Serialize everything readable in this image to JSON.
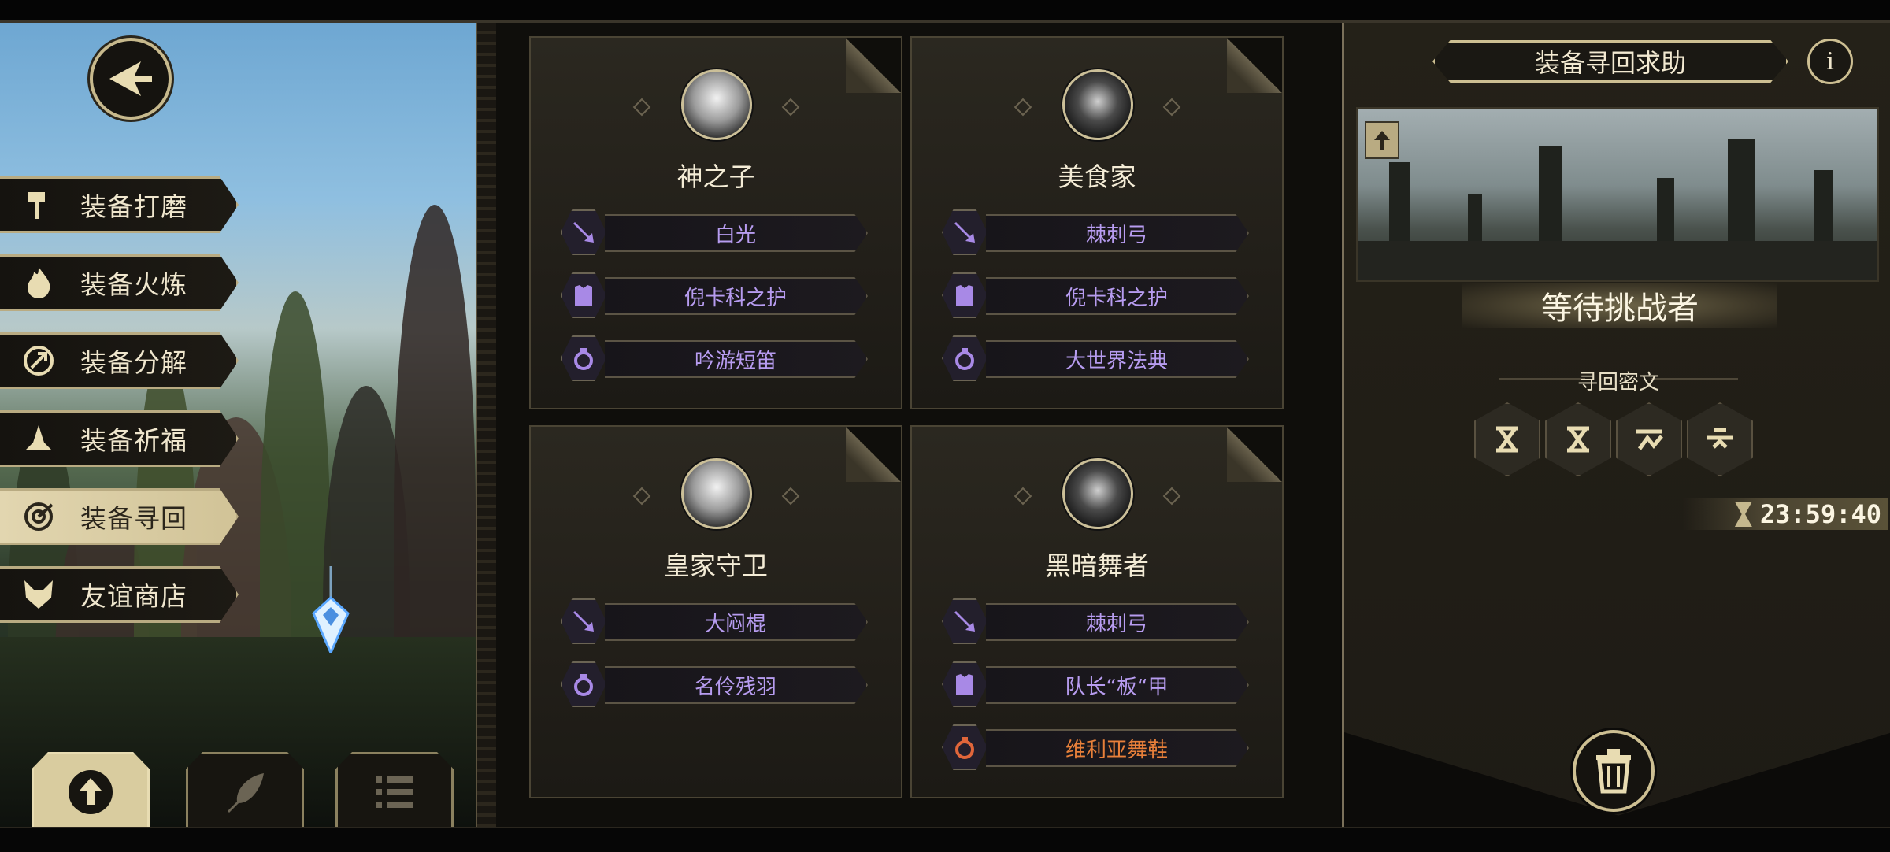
{
  "side_menu": {
    "items": [
      {
        "label": "装备打磨",
        "icon": "hammer-icon"
      },
      {
        "label": "装备火炼",
        "icon": "flame-icon"
      },
      {
        "label": "装备分解",
        "icon": "disassemble-icon"
      },
      {
        "label": "装备祈福",
        "icon": "pray-icon"
      },
      {
        "label": "装备寻回",
        "icon": "retrieve-icon",
        "active": true
      },
      {
        "label": "友谊商店",
        "icon": "fox-icon"
      }
    ]
  },
  "bottom_tabs": [
    {
      "icon": "upload-icon",
      "active": true
    },
    {
      "icon": "feather-icon",
      "active": false
    },
    {
      "icon": "list-icon",
      "active": false
    }
  ],
  "cards": [
    {
      "name": "神之子",
      "items": [
        {
          "slot": "weapon",
          "icon": "sword-icon",
          "name": "白光"
        },
        {
          "slot": "armor",
          "icon": "armor-icon",
          "name": "倪卡科之护"
        },
        {
          "slot": "accessory",
          "icon": "ring-icon",
          "name": "吟游短笛"
        }
      ]
    },
    {
      "name": "美食家",
      "items": [
        {
          "slot": "weapon",
          "icon": "sword-icon",
          "name": "棘刺弓"
        },
        {
          "slot": "armor",
          "icon": "armor-icon",
          "name": "倪卡科之护"
        },
        {
          "slot": "accessory",
          "icon": "ring-icon",
          "name": "大世界法典"
        }
      ]
    },
    {
      "name": "皇家守卫",
      "items": [
        {
          "slot": "weapon",
          "icon": "sword-icon",
          "name": "大闷棍"
        },
        {
          "slot": "accessory",
          "icon": "ring-icon",
          "name": "名伶残羽"
        }
      ]
    },
    {
      "name": "黑暗舞者",
      "items": [
        {
          "slot": "weapon",
          "icon": "sword-icon",
          "name": "棘刺弓"
        },
        {
          "slot": "armor",
          "icon": "armor-icon",
          "name": "队长“板“甲"
        },
        {
          "slot": "accessory",
          "icon": "ring-icon",
          "name": "维利亚舞鞋",
          "rarity_color": "#e8803a"
        }
      ]
    }
  ],
  "right_panel": {
    "title": "装备寻回求助",
    "info_label": "i",
    "status": "等待挑战者",
    "cipher_label": "寻回密文",
    "runes": [
      "rune-x-icon",
      "rune-x-icon",
      "rune-wave-icon",
      "rune-cross-icon"
    ],
    "timer": "23:59:40"
  },
  "colors": {
    "gold_border": "#cdbf92",
    "item_purple": "#b79cf0",
    "item_orange": "#e8803a",
    "panel_bg": "#242118"
  }
}
